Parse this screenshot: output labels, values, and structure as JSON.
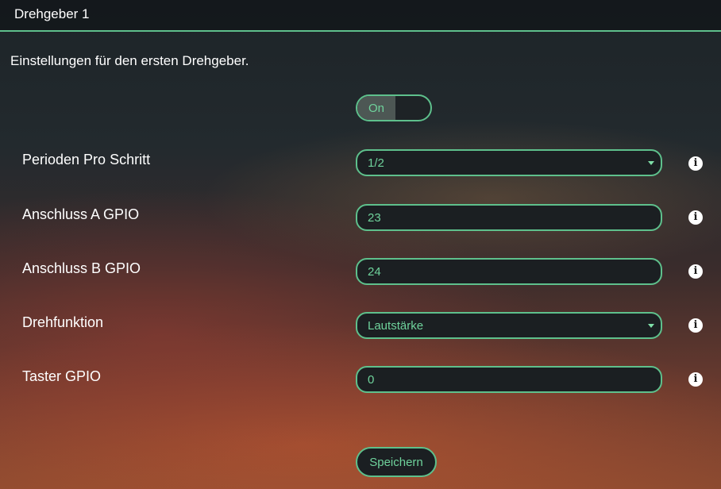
{
  "header": {
    "title": "Drehgeber 1"
  },
  "description": "Einstellungen für den ersten Drehgeber.",
  "toggle": {
    "label": "On",
    "state": "on"
  },
  "fields": [
    {
      "label": "Perioden Pro Schritt",
      "value": "1/2",
      "type": "select"
    },
    {
      "label": "Anschluss A GPIO",
      "value": "23",
      "type": "input"
    },
    {
      "label": "Anschluss B GPIO",
      "value": "24",
      "type": "input"
    },
    {
      "label": "Drehfunktion",
      "value": "Lautstärke",
      "type": "select"
    },
    {
      "label": "Taster GPIO",
      "value": "0",
      "type": "input"
    }
  ],
  "info_icon": "i",
  "save_label": "Speichern",
  "colors": {
    "accent": "#5ec08c",
    "accent_text": "#6fd39c"
  }
}
